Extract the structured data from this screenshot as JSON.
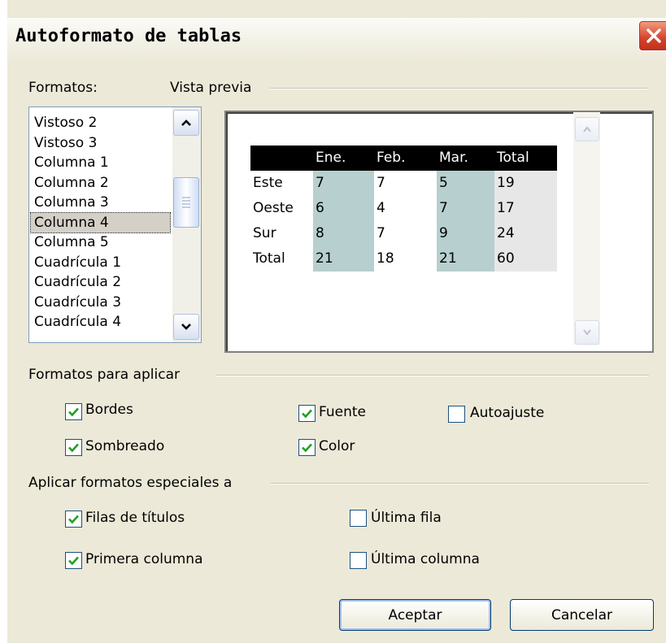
{
  "dialog": {
    "title": "Autoformato de tablas",
    "close_icon": "close-x-icon"
  },
  "formatos": {
    "label": "Formatos:",
    "items": [
      "Vistoso 2",
      "Vistoso 3",
      "Columna 1",
      "Columna 2",
      "Columna 3",
      "Columna 4",
      "Columna 5",
      "Cuadrícula 1",
      "Cuadrícula 2",
      "Cuadrícula 3",
      "Cuadrícula 4"
    ],
    "selected": "Columna 4"
  },
  "preview": {
    "label": "Vista previa",
    "header": [
      "",
      "Ene.",
      "Feb.",
      "Mar.",
      "Total"
    ],
    "rows": [
      [
        "Este",
        "7",
        "7",
        "5",
        "19"
      ],
      [
        "Oeste",
        "6",
        "4",
        "7",
        "17"
      ],
      [
        "Sur",
        "8",
        "7",
        "9",
        "24"
      ],
      [
        "Total",
        "21",
        "18",
        "21",
        "60"
      ]
    ]
  },
  "apply_formats": {
    "label": "Formatos para aplicar",
    "bordes": {
      "label": "Bordes",
      "checked": true
    },
    "fuente": {
      "label": "Fuente",
      "checked": true
    },
    "autoajuste": {
      "label": "Autoajuste",
      "checked": false
    },
    "sombreado": {
      "label": "Sombreado",
      "checked": true
    },
    "color": {
      "label": "Color",
      "checked": true
    }
  },
  "special_formats": {
    "label": "Aplicar formatos especiales a",
    "filas_titulos": {
      "label": "Filas de títulos",
      "checked": true
    },
    "ultima_fila": {
      "label": "Última fila",
      "checked": false
    },
    "primera_columna": {
      "label": "Primera columna",
      "checked": true
    },
    "ultima_columna": {
      "label": "Última columna",
      "checked": false
    }
  },
  "buttons": {
    "aceptar": "Aceptar",
    "cancelar": "Cancelar"
  },
  "colors": {
    "check": "#21a121",
    "header_bg": "#000000",
    "teal_col": "#b7cfcf",
    "close_red": "#d4422b"
  }
}
